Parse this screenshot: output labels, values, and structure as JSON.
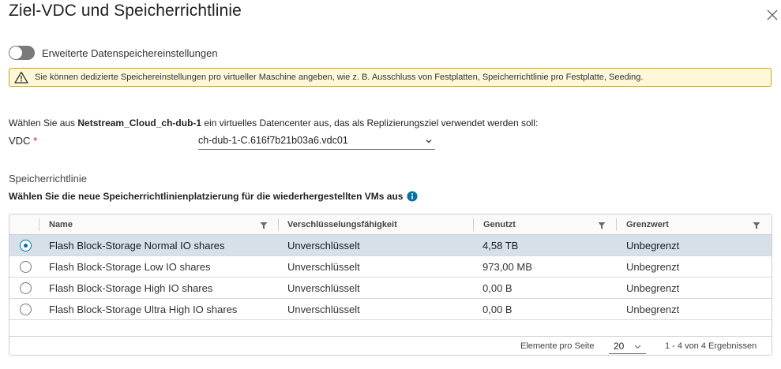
{
  "dialog": {
    "title": "Ziel-VDC und Speicherrichtlinie"
  },
  "advanced_toggle": {
    "label": "Erweiterte Datenspeichereinstellungen",
    "on": false
  },
  "warning": {
    "text": "Sie können dedizierte Speichereinstellungen pro virtueller Maschine angeben, wie z. B. Ausschluss von Festplatten, Speicherrichtlinie pro Festplatte, Seeding."
  },
  "vdc": {
    "instruction_prefix": "Wählen Sie aus ",
    "instruction_bold": "Netstream_Cloud_ch-dub-1",
    "instruction_suffix": " ein virtuelles Datencenter aus, das als Replizierungsziel verwendet werden soll:",
    "label": "VDC",
    "required_marker": "*",
    "selected_value": "ch-dub-1-C.616f7b21b03a6.vdc01"
  },
  "storage_policy": {
    "section_title": "Speicherrichtlinie",
    "instruction": "Wählen Sie die neue Speicherrichtlinienplatzierung für die wiederhergestellten VMs aus"
  },
  "grid": {
    "columns": {
      "name": "Name",
      "encryption": "Verschlüsselungsfähigkeit",
      "used": "Genutzt",
      "limit": "Grenzwert"
    },
    "rows": [
      {
        "name": "Flash Block-Storage Normal IO shares",
        "encryption": "Unverschlüsselt",
        "used": "4,58 TB",
        "limit": "Unbegrenzt",
        "selected": true
      },
      {
        "name": "Flash Block-Storage Low IO shares",
        "encryption": "Unverschlüsselt",
        "used": "973,00 MB",
        "limit": "Unbegrenzt",
        "selected": false
      },
      {
        "name": "Flash Block-Storage High IO shares",
        "encryption": "Unverschlüsselt",
        "used": "0,00 B",
        "limit": "Unbegrenzt",
        "selected": false
      },
      {
        "name": "Flash Block-Storage Ultra High IO shares",
        "encryption": "Unverschlüsselt",
        "used": "0,00 B",
        "limit": "Unbegrenzt",
        "selected": false
      }
    ],
    "footer": {
      "page_size_label": "Elemente pro Seite",
      "page_size": "20",
      "count_text": "1 - 4 von 4 Ergebnissen"
    }
  },
  "colors": {
    "accent": "#0072a3",
    "selected_row": "#d6e0e8",
    "warning_bg": "#fef8d9",
    "warning_border": "#c9a800",
    "required": "#c92100"
  },
  "icons": [
    "close-icon",
    "warning-icon",
    "chevron-down-icon",
    "info-icon",
    "filter-icon"
  ]
}
